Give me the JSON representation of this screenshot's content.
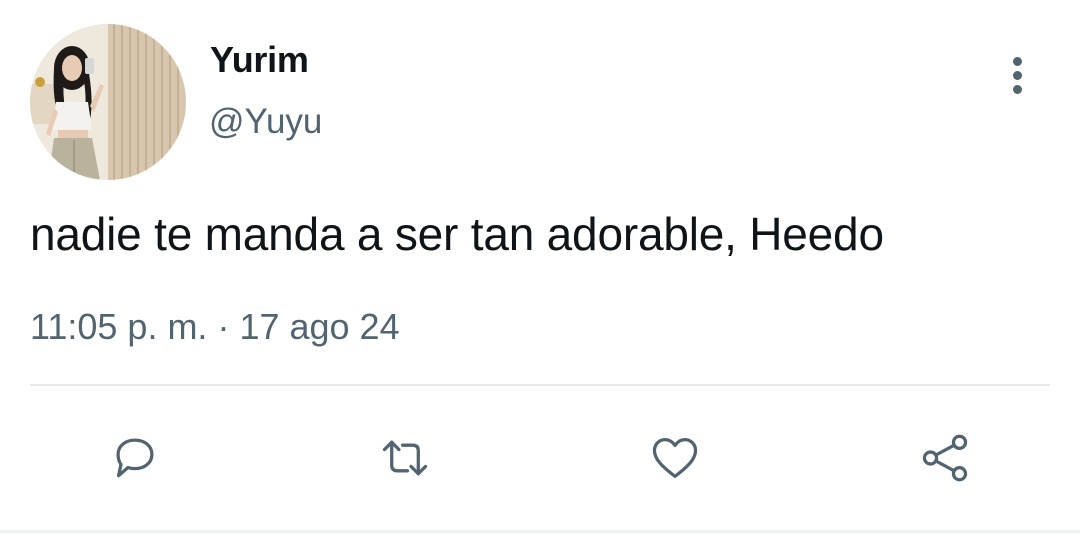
{
  "tweet": {
    "display_name": "Yurim",
    "handle": "@Yuyu",
    "text": "nadie te manda a ser tan adorable, Heedo",
    "time": "11:05 p. m.",
    "separator": "·",
    "date": "17 ago 24"
  },
  "actions": {
    "reply_icon": "reply-bubble-icon",
    "retweet_icon": "retweet-icon",
    "like_icon": "heart-icon",
    "share_icon": "share-icon"
  },
  "colors": {
    "text_primary": "#0f1419",
    "text_secondary": "#536471",
    "divider": "#e7eaec"
  }
}
